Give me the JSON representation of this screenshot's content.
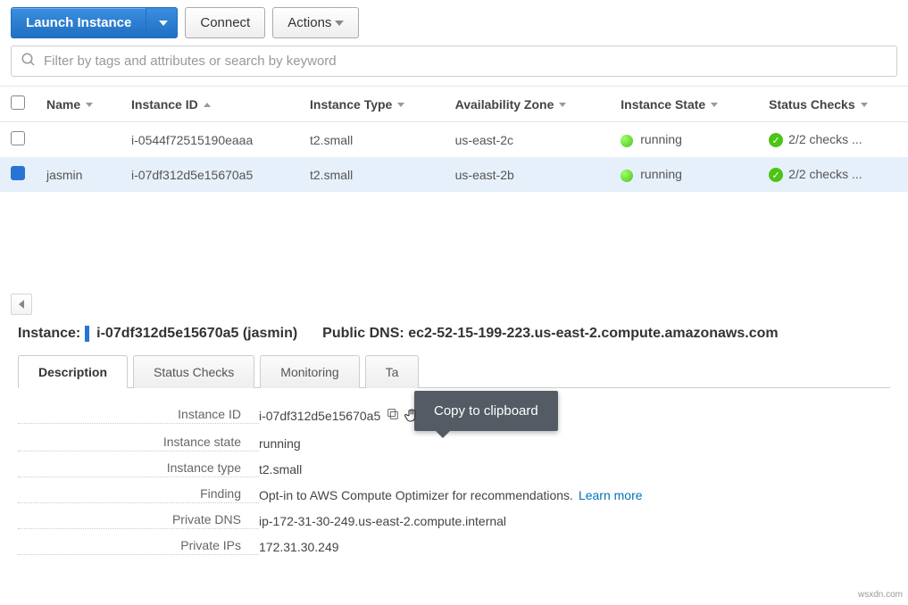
{
  "toolbar": {
    "launch": "Launch Instance",
    "connect": "Connect",
    "actions": "Actions"
  },
  "search": {
    "placeholder": "Filter by tags and attributes or search by keyword"
  },
  "columns": {
    "name": "Name",
    "instance_id": "Instance ID",
    "instance_type": "Instance Type",
    "availability_zone": "Availability Zone",
    "instance_state": "Instance State",
    "status_checks": "Status Checks"
  },
  "rows": [
    {
      "name": "",
      "id": "i-0544f72515190eaaa",
      "type": "t2.small",
      "az": "us-east-2c",
      "state": "running",
      "checks": "2/2 checks ..."
    },
    {
      "name": "jasmin",
      "id": "i-07df312d5e15670a5",
      "type": "t2.small",
      "az": "us-east-2b",
      "state": "running",
      "checks": "2/2 checks ..."
    }
  ],
  "detail": {
    "instance_label": "Instance:",
    "instance_value": "i-07df312d5e15670a5 (jasmin)",
    "public_dns_label": "Public DNS:",
    "public_dns_value": "ec2-52-15-199-223.us-east-2.compute.amazonaws.com"
  },
  "tabs": {
    "description": "Description",
    "status_checks": "Status Checks",
    "monitoring": "Monitoring",
    "tags_partial": "Ta"
  },
  "kv": {
    "instance_id_label": "Instance ID",
    "instance_id_value": "i-07df312d5e15670a5",
    "instance_state_label": "Instance state",
    "instance_state_value": "running",
    "instance_type_label": "Instance type",
    "instance_type_value": "t2.small",
    "finding_label": "Finding",
    "finding_value": "Opt-in to AWS Compute Optimizer for recommendations.",
    "finding_link": "Learn more",
    "private_dns_label": "Private DNS",
    "private_dns_value": "ip-172-31-30-249.us-east-2.compute.internal",
    "private_ips_label": "Private IPs",
    "private_ips_value": "172.31.30.249"
  },
  "tooltip": "Copy to clipboard",
  "watermark": "wsxdn.com"
}
